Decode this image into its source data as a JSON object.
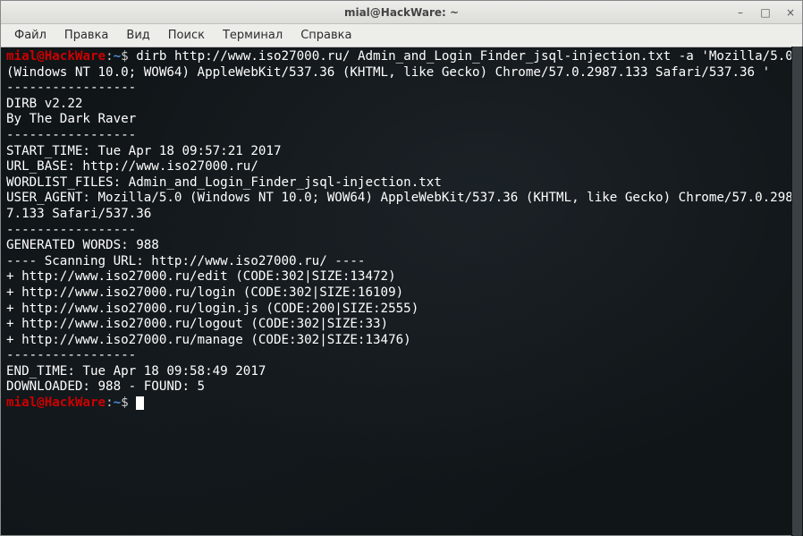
{
  "titlebar": {
    "title": "mial@HackWare: ~",
    "minimize": "–",
    "maximize": "□",
    "close": "×"
  },
  "menubar": {
    "file": "Файл",
    "edit": "Правка",
    "view": "Вид",
    "search": "Поиск",
    "terminal": "Терминал",
    "help": "Справка"
  },
  "prompt": {
    "user": "mial",
    "at": "@",
    "host": "HackWare",
    "sep": ":",
    "path": "~",
    "dollar": "$"
  },
  "command": " dirb http://www.iso27000.ru/ Admin_and_Login_Finder_jsql-injection.txt -a 'Mozilla/5.0 (Windows NT 10.0; WOW64) AppleWebKit/537.36 (KHTML, like Gecko) Chrome/57.0.2987.133 Safari/537.36 '",
  "output": {
    "l0": "",
    "l1": "-----------------",
    "l2": "DIRB v2.22",
    "l3": "By The Dark Raver",
    "l4": "-----------------",
    "l5": "",
    "l6": "START_TIME: Tue Apr 18 09:57:21 2017",
    "l7": "URL_BASE: http://www.iso27000.ru/",
    "l8": "WORDLIST_FILES: Admin_and_Login_Finder_jsql-injection.txt",
    "l9": "USER_AGENT: Mozilla/5.0 (Windows NT 10.0; WOW64) AppleWebKit/537.36 (KHTML, like Gecko) Chrome/57.0.2987.133 Safari/537.36",
    "l10": "",
    "l11": "-----------------",
    "l12": "",
    "l13": "GENERATED WORDS: 988",
    "l14": "",
    "l15": "---- Scanning URL: http://www.iso27000.ru/ ----",
    "l16": "+ http://www.iso27000.ru/edit (CODE:302|SIZE:13472)",
    "l17": "+ http://www.iso27000.ru/login (CODE:302|SIZE:16109)",
    "l18": "+ http://www.iso27000.ru/login.js (CODE:200|SIZE:2555)",
    "l19": "+ http://www.iso27000.ru/logout (CODE:302|SIZE:33)",
    "l20": "+ http://www.iso27000.ru/manage (CODE:302|SIZE:13476)",
    "l21": "",
    "l22": "-----------------",
    "l23": "END_TIME: Tue Apr 18 09:58:49 2017",
    "l24": "DOWNLOADED: 988 - FOUND: 5"
  }
}
